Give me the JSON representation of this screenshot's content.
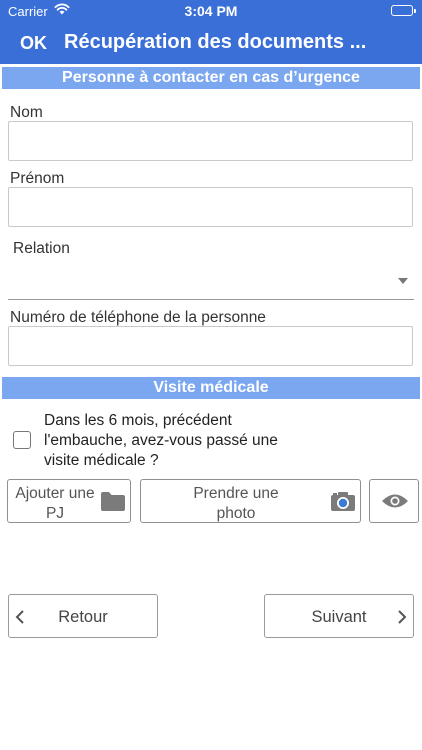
{
  "status_bar": {
    "carrier": "Carrier",
    "time": "3:04 PM"
  },
  "nav": {
    "ok_label": "OK",
    "title": "Récupération des documents ..."
  },
  "emergency_section": {
    "header": "Personne à contacter en cas d’urgence",
    "nom_label": "Nom",
    "nom_value": "",
    "prenom_label": "Prénom",
    "prenom_value": "",
    "relation_label": "Relation",
    "relation_value": "",
    "phone_label": "Numéro de téléphone de la personne",
    "phone_value": ""
  },
  "medical_section": {
    "header": "Visite médicale",
    "question": "Dans les 6 mois, précédent l'embauche, avez-vous passé une visite médicale ?",
    "checked": false,
    "attach_label": "Ajouter une PJ",
    "photo_label": "Prendre une photo"
  },
  "footer": {
    "back_label": "Retour",
    "next_label": "Suivant"
  },
  "icons": {
    "wifi": "wifi-icon",
    "battery": "battery-icon",
    "folder": "folder-icon",
    "camera": "camera-icon",
    "eye": "eye-icon",
    "back": "chevron-left-icon",
    "next": "chevron-right-icon",
    "dropdown": "dropdown-arrow-icon"
  },
  "colors": {
    "nav_bar": "#3a6fd8",
    "section_header": "#7aa7ef",
    "icon_gray": "#777777",
    "camera_lens": "#3a7bd5"
  }
}
